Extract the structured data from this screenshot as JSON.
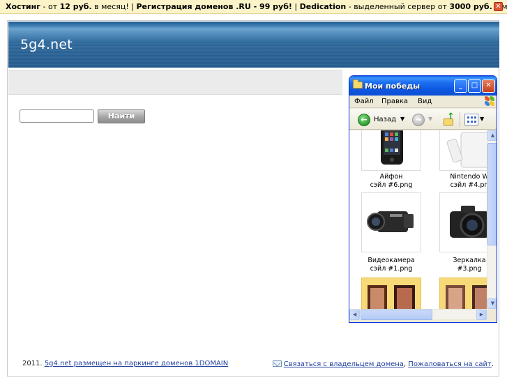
{
  "promo": {
    "hosting_b": "Хостинг",
    "hosting_t1": " - от ",
    "hosting_price": "12 руб.",
    "hosting_t2": " в месяц! | ",
    "domains_b": "Регистрация доменов .RU - 99 руб!",
    "sep": " | ",
    "dedicated_b": "Dedication",
    "dedicated_t1": " - выделенный сервер от ",
    "dedicated_price": "3000 руб.",
    "dedicated_t2": " в месяц",
    "close_glyph": "✕"
  },
  "site": {
    "title": "5g4.net"
  },
  "search": {
    "placeholder": "",
    "button_label": "Найти"
  },
  "footer": {
    "year_text": "2011. ",
    "parking_link": "5g4.net размещен на паркинге доменов 1DOMAIN",
    "contact_link": "Связаться с владельцем домена",
    "sep": ", ",
    "complain_link": "Пожаловаться на сайт",
    "end": "."
  },
  "xp_window": {
    "title": "Мои победы",
    "menu": [
      "Файл",
      "Правка",
      "Вид"
    ],
    "back_label": "Назад",
    "back_glyph": "←",
    "fwd_glyph": "→",
    "up_glyph": "↑",
    "min_glyph": "_",
    "max_glyph": "□",
    "close_glyph": "✕",
    "drop_glyph": "▼",
    "scroll_up_glyph": "▲",
    "scroll_down_glyph": "▼",
    "scroll_left_glyph": "◀",
    "scroll_right_glyph": "▶",
    "files": [
      {
        "line1": "Айфон",
        "line2": "сэйл #6.png"
      },
      {
        "line1": "Nintendo W",
        "line2": "сэйл #4.pn"
      },
      {
        "line1": "Видеокамера",
        "line2": "сэйл #1.png"
      },
      {
        "line1": "Зеркалка",
        "line2": "#3.png"
      }
    ]
  },
  "colors": {
    "header": "#2f6a9d",
    "promo_bg": "#fdf3c9",
    "link": "#1e3f9c",
    "xp_blue": "#0b4fd4"
  }
}
